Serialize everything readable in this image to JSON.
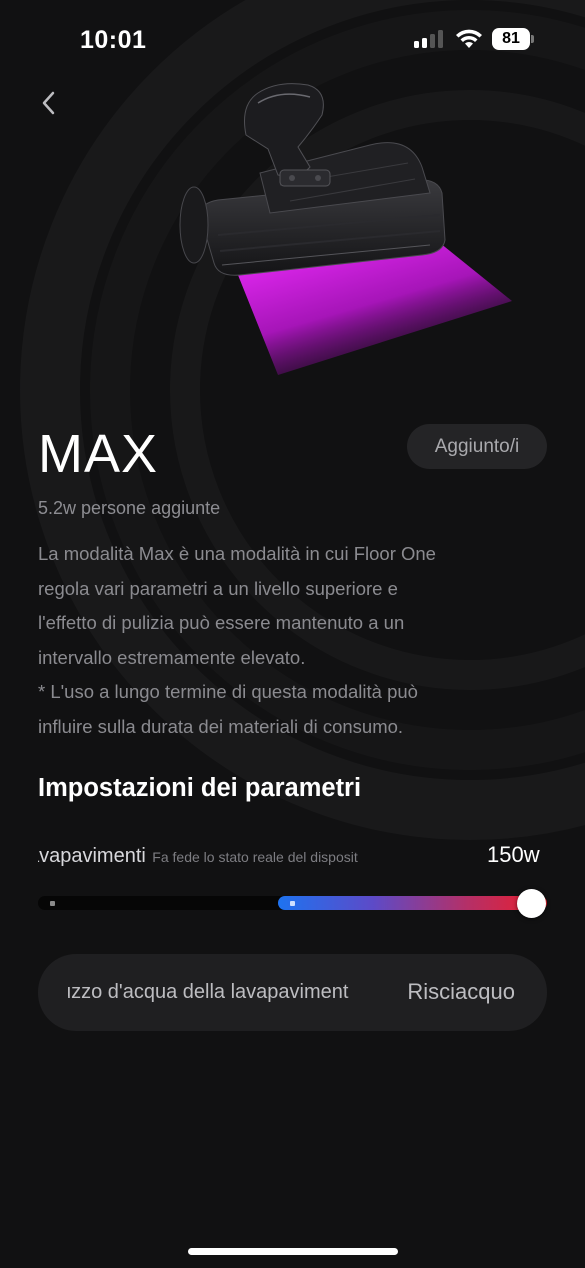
{
  "status_bar": {
    "time": "10:01",
    "battery": "81"
  },
  "navigation": {
    "back_icon": "chevron-left-icon"
  },
  "hero": {
    "device_icon": "floor-washer-device-illustration",
    "glow_color": "#e020f0"
  },
  "mode": {
    "title": "MAX",
    "added_label": "Aggiunto/i",
    "users_count": "5.2w persone aggiunte",
    "description": [
      "La modalità Max è una modalità in cui Floor One",
      "regola vari parametri a un livello superiore e",
      "l'effetto di pulizia può essere mantenuto a un",
      "intervallo estremamente elevato.",
      "* L'uso a lungo termine di questa modalità può",
      "influire sulla durata dei materiali di consumo."
    ]
  },
  "settings": {
    "section_title": "Impostazioni dei parametri",
    "suction": {
      "label": "avapavimenti",
      "sub_label": "Fa fede lo stato reale del disposit",
      "value": "150w",
      "level_fraction": 0.97,
      "gradient_colors": [
        "#1e73f0",
        "#ee1d2a"
      ]
    },
    "water": {
      "label": "uzzo d'acqua della lavapaviment",
      "value": "Risciacquo"
    }
  }
}
